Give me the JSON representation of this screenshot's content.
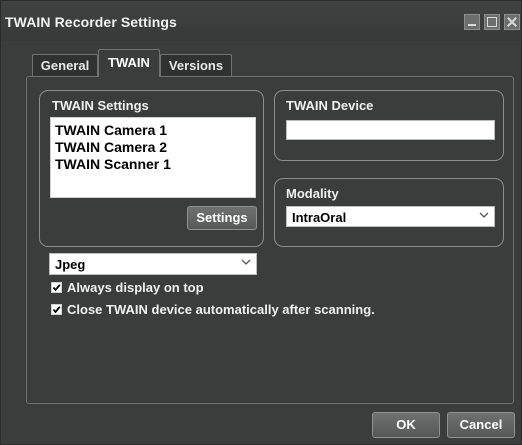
{
  "window": {
    "title": "TWAIN Recorder Settings"
  },
  "tabs": [
    {
      "label": "General",
      "selected": false
    },
    {
      "label": "TWAIN",
      "selected": true
    },
    {
      "label": "Versions",
      "selected": false
    }
  ],
  "twain_settings": {
    "title": "TWAIN Settings",
    "items": [
      "TWAIN Camera 1",
      "TWAIN Camera 2",
      "TWAIN Scanner 1"
    ],
    "settings_button": "Settings"
  },
  "twain_device": {
    "title": "TWAIN Device",
    "value": ""
  },
  "modality": {
    "title": "Modality",
    "selected": "IntraOral"
  },
  "format": {
    "selected": "Jpeg"
  },
  "options": {
    "always_on_top": {
      "label": "Always display on top",
      "checked": true
    },
    "close_after_scan": {
      "label": "Close TWAIN device automatically after scanning.",
      "checked": true
    }
  },
  "footer": {
    "ok_label": "OK",
    "cancel_label": "Cancel"
  },
  "icons": {
    "minimize": "minimize-icon",
    "maximize": "maximize-icon",
    "close": "close-icon",
    "dropdown": "chevron-down-icon",
    "checkmark": "checkmark-icon"
  },
  "colors": {
    "window_bg": "#3a3d3b",
    "text": "#f0f0f0",
    "button_bg": "#5f6261"
  }
}
